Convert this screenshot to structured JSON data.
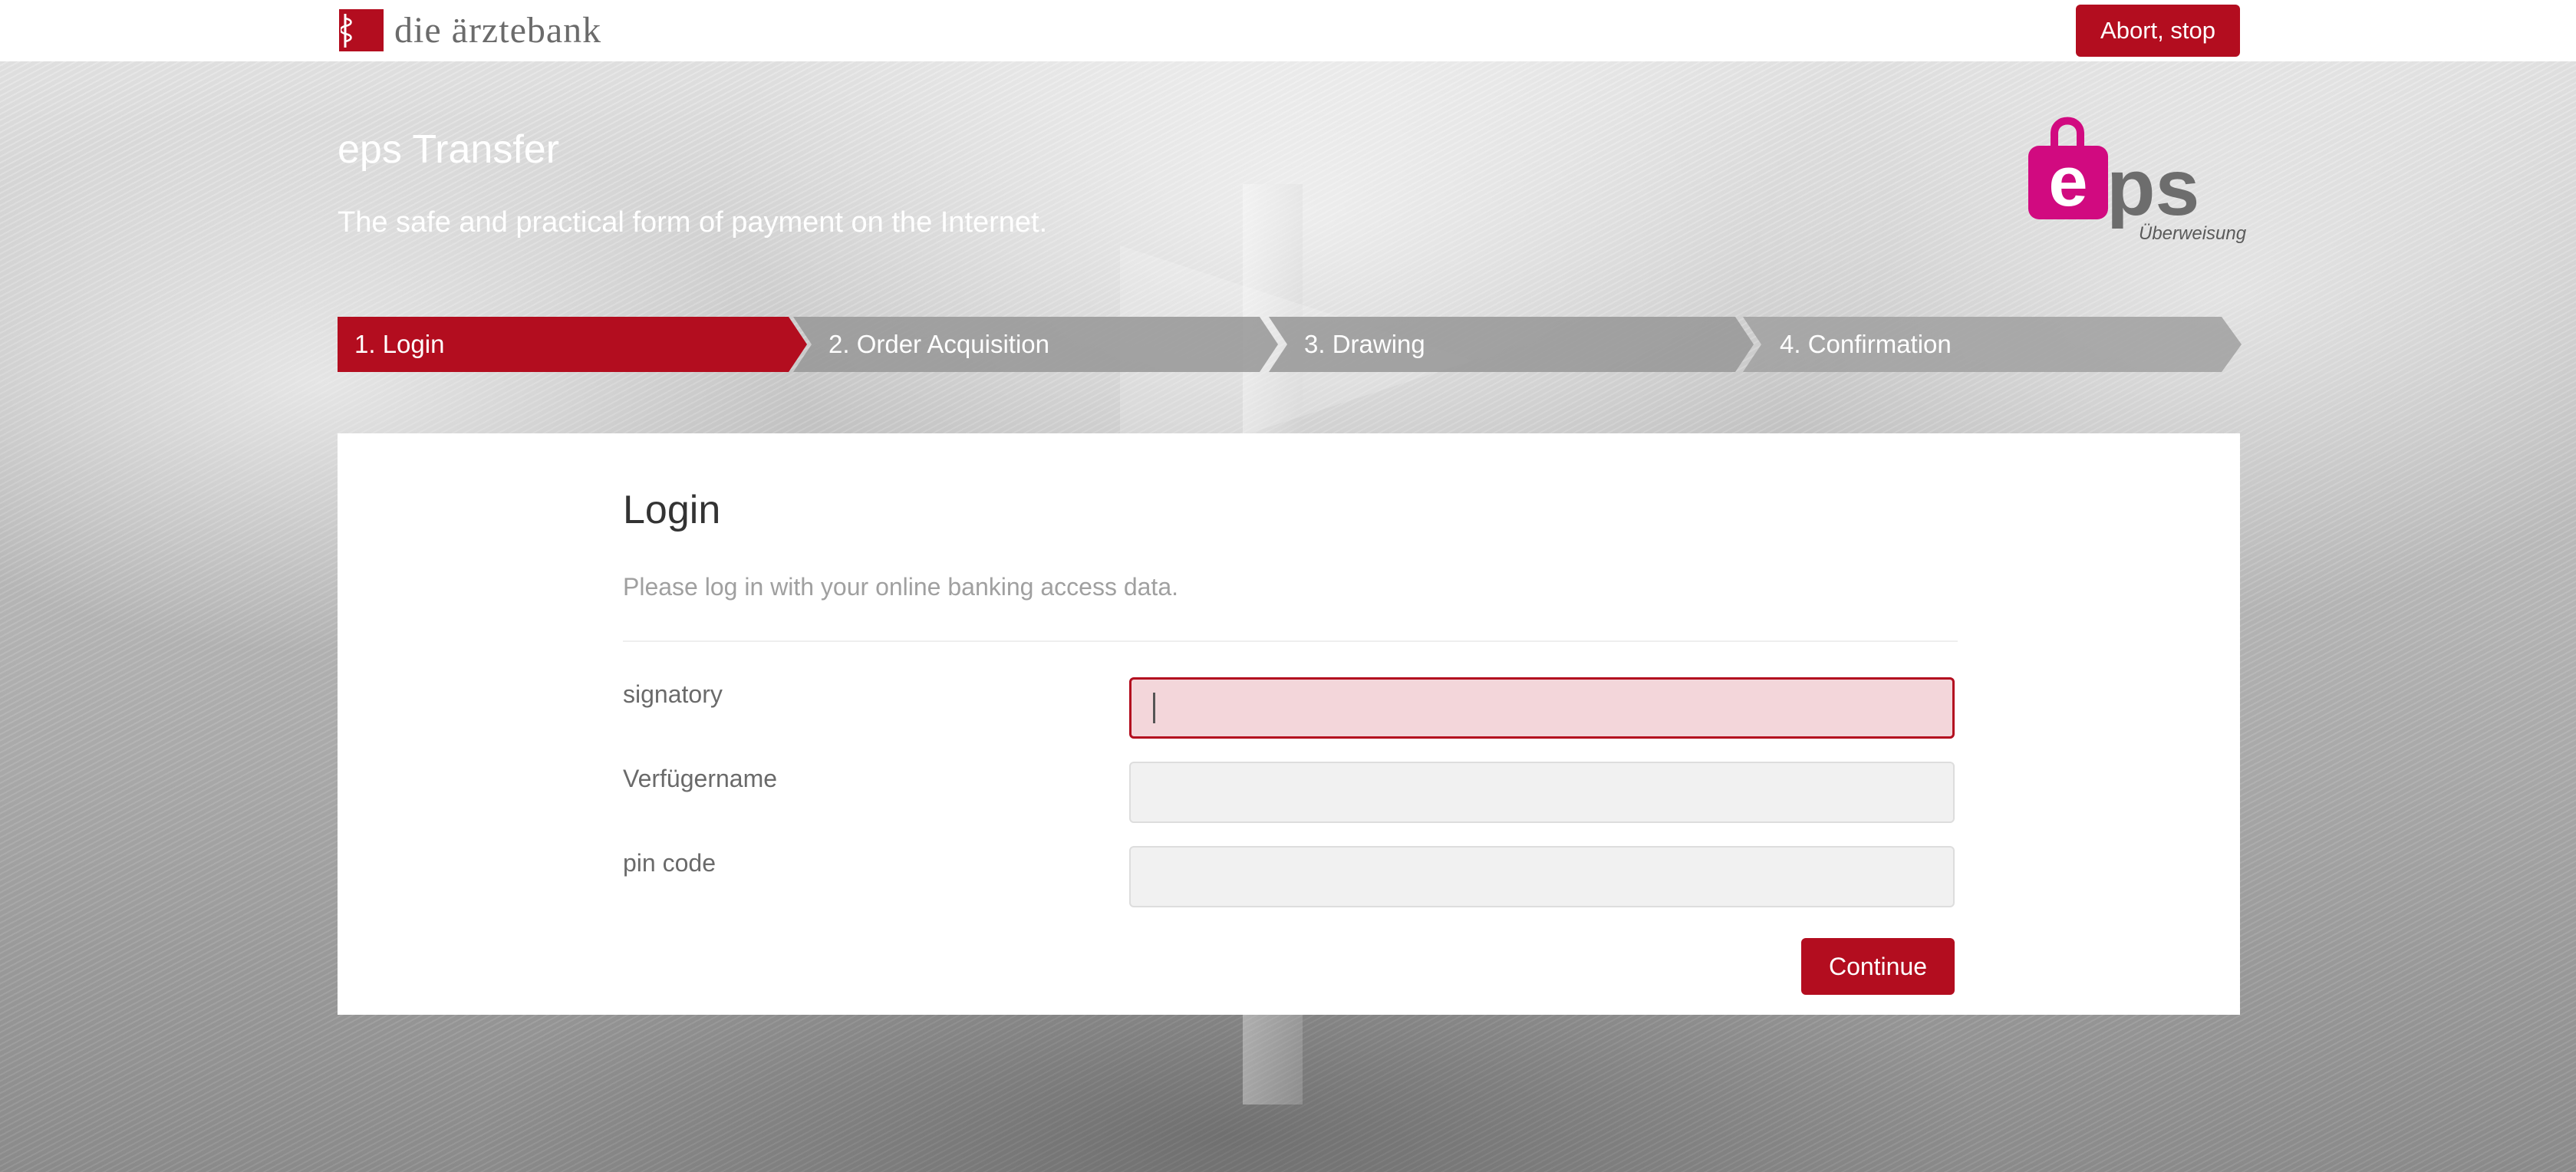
{
  "bank": {
    "name": "die ärztebank"
  },
  "header": {
    "abort_label": "Abort, stop",
    "title": "eps Transfer",
    "subtitle": "The safe and practical form of payment on the Internet."
  },
  "eps_logo": {
    "text": "eps",
    "sub": "Überweisung",
    "colors": {
      "pink": "#d10a80",
      "grey": "#6d6d6d"
    }
  },
  "stepper": {
    "steps": [
      {
        "label": "1. Login",
        "active": true
      },
      {
        "label": "2. Order Acquisition",
        "active": false
      },
      {
        "label": "3. Drawing",
        "active": false
      },
      {
        "label": "4. Confirmation",
        "active": false
      }
    ]
  },
  "login": {
    "title": "Login",
    "description": "Please log in with your online banking access data.",
    "fields": [
      {
        "label": "signatory",
        "value": "",
        "state": "error"
      },
      {
        "label": "Verfügername",
        "value": "",
        "state": "normal"
      },
      {
        "label": "pin code",
        "value": "",
        "state": "normal"
      }
    ],
    "continue_label": "Continue"
  },
  "colors": {
    "brand_red": "#b30d1f",
    "error_bg": "#f3d6da",
    "step_inactive": "#969696"
  }
}
